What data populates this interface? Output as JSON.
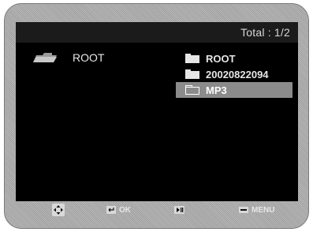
{
  "header": {
    "total_text": "Total : 1/2"
  },
  "left_panel": {
    "item_label": "ROOT",
    "icon": "parent-folder-icon"
  },
  "folder_list": [
    {
      "label": "ROOT",
      "selected": false,
      "icon": "folder-icon"
    },
    {
      "label": "20020822094",
      "selected": false,
      "icon": "folder-icon"
    },
    {
      "label": "MP3",
      "selected": true,
      "icon": "folder-outline-icon"
    }
  ],
  "footer": {
    "nav_icon": "dpad-icon",
    "ok_label": "OK",
    "play_icon": "play-pause-icon",
    "menu_label": "MENU"
  }
}
